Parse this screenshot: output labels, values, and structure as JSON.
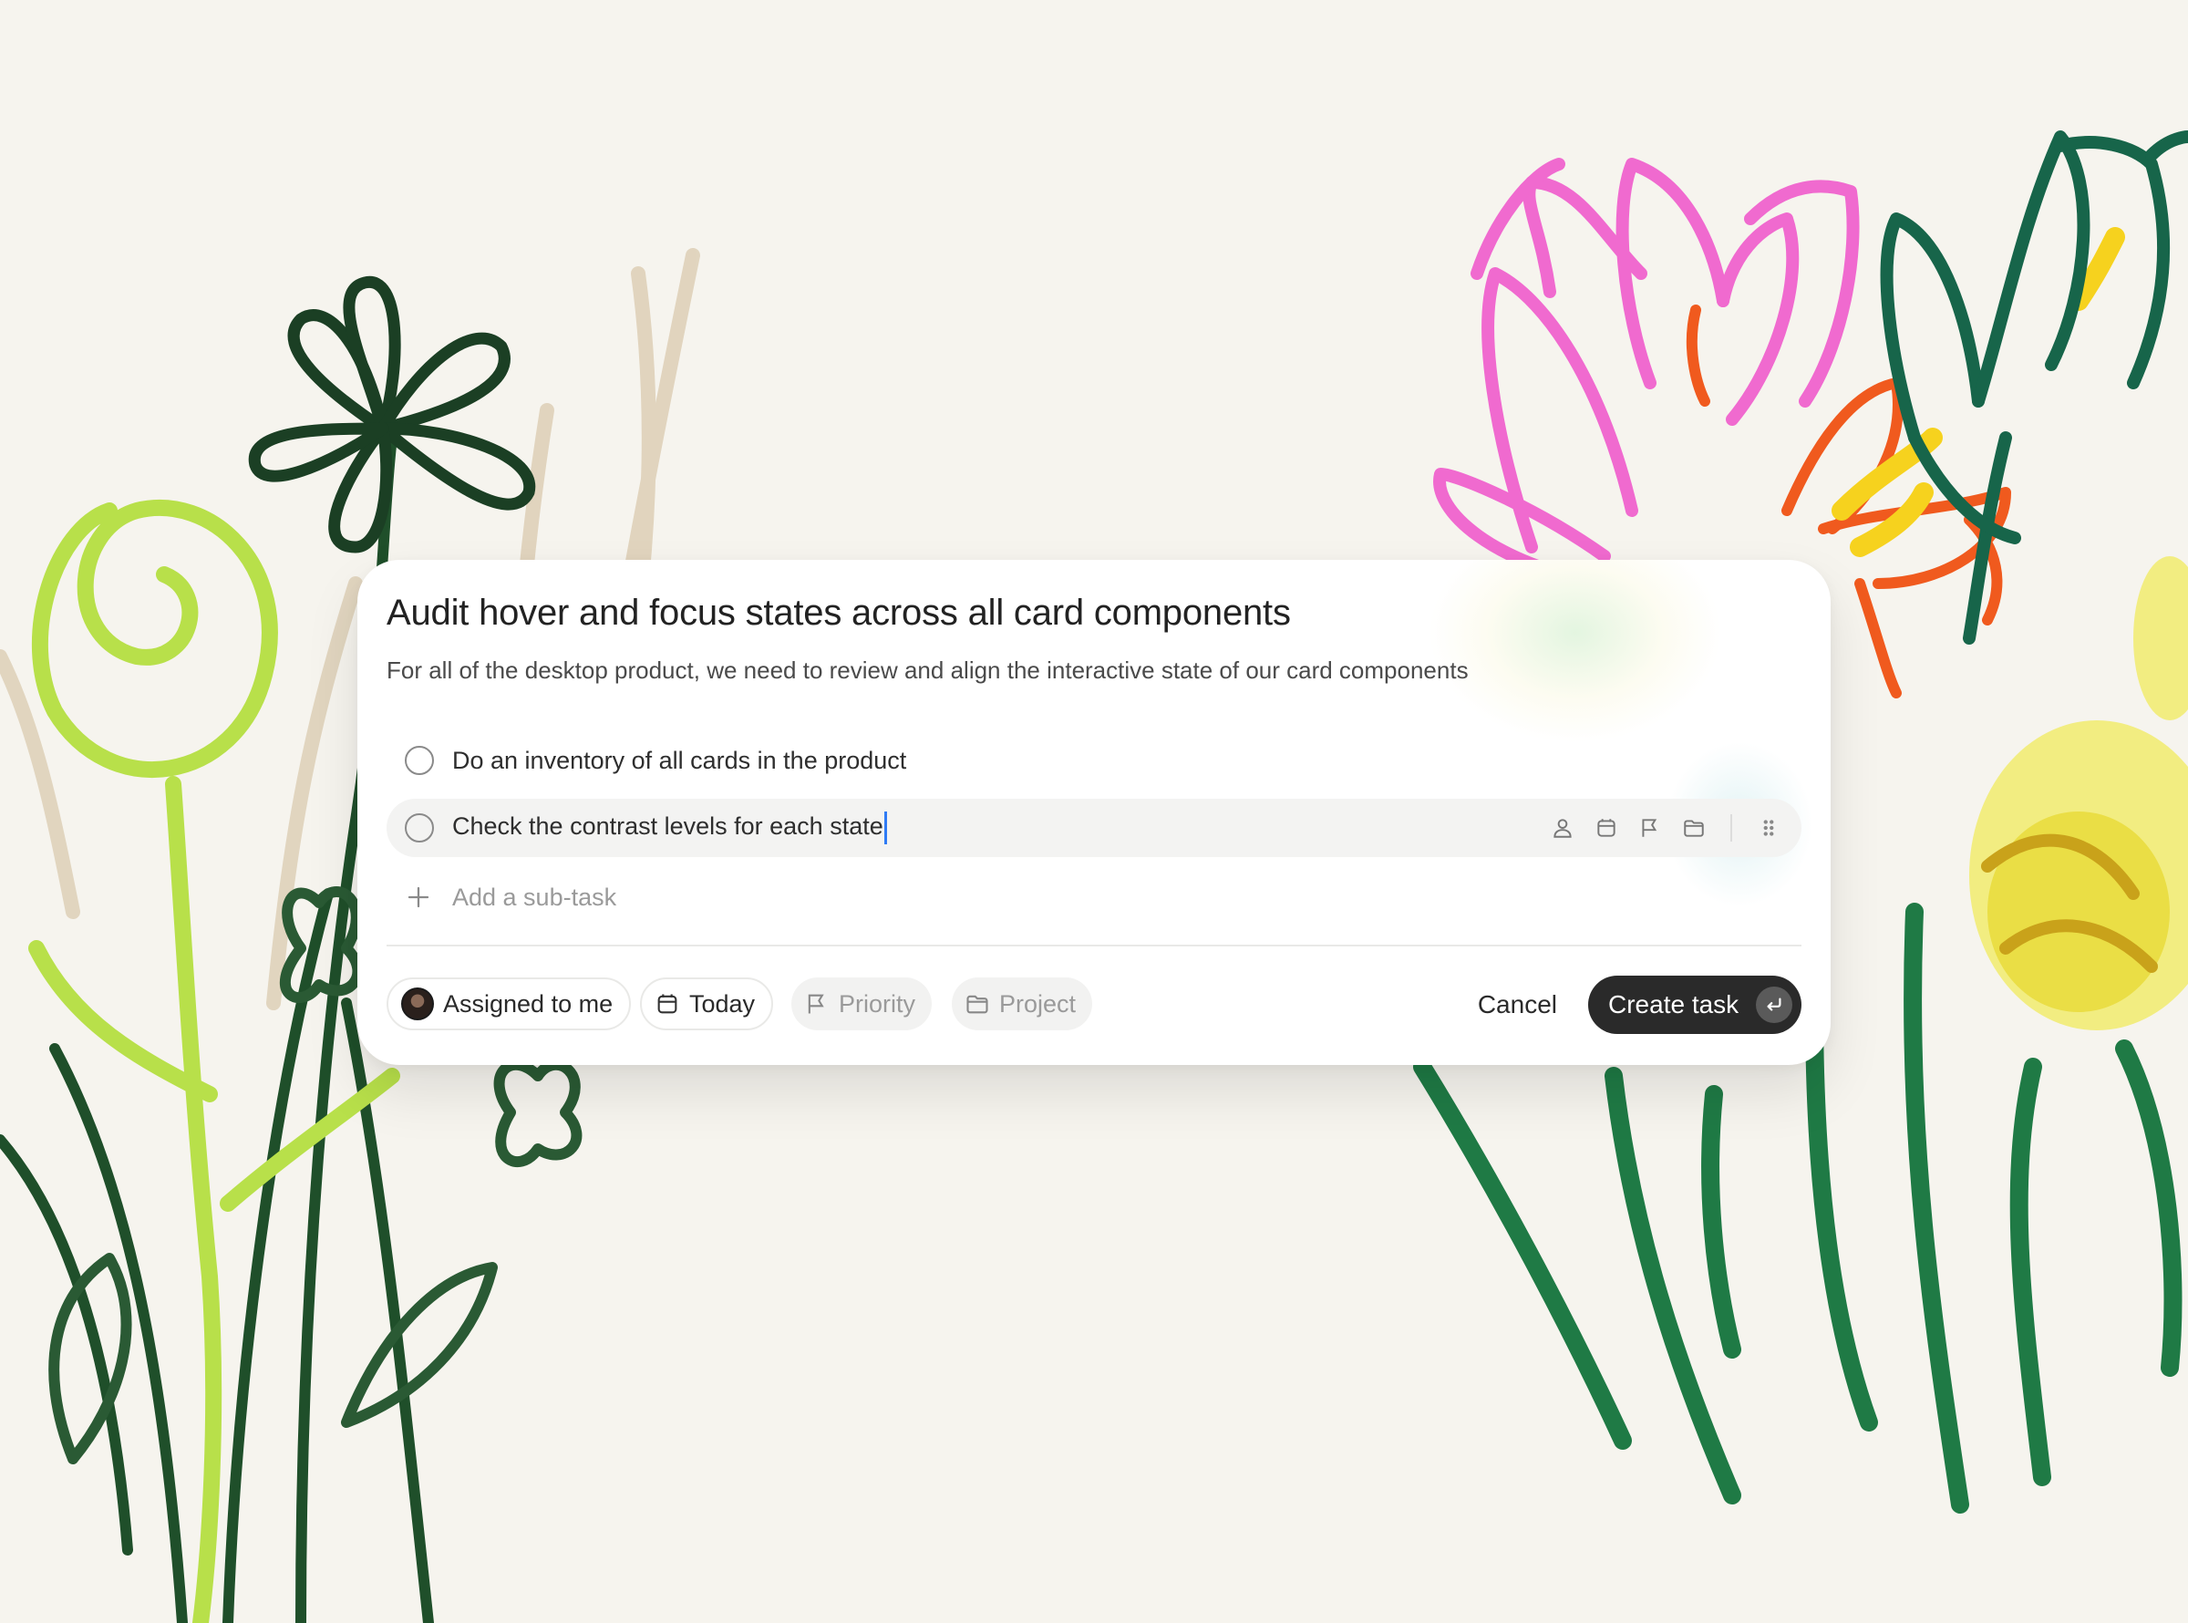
{
  "task": {
    "title": "Audit hover and focus states across all card components",
    "description": "For all of the desktop product, we need to review and align the interactive state of our card components",
    "subtasks": [
      {
        "label": "Do an inventory of all cards in the product",
        "active": false
      },
      {
        "label": "Check the contrast levels for each state",
        "active": true
      }
    ],
    "add_subtask_placeholder": "Add a sub-task",
    "row_tool_icons": [
      "user-icon",
      "calendar-icon",
      "flag-icon",
      "folder-icon",
      "drag-handle-icon"
    ]
  },
  "footer": {
    "assignee_label": "Assigned to me",
    "date_label": "Today",
    "priority_label": "Priority",
    "project_label": "Project",
    "cancel_label": "Cancel",
    "create_label": "Create task"
  },
  "colors": {
    "background": "#f6f4ee",
    "accent_dark": "#2a2a2a",
    "caret": "#2f7bf5"
  }
}
